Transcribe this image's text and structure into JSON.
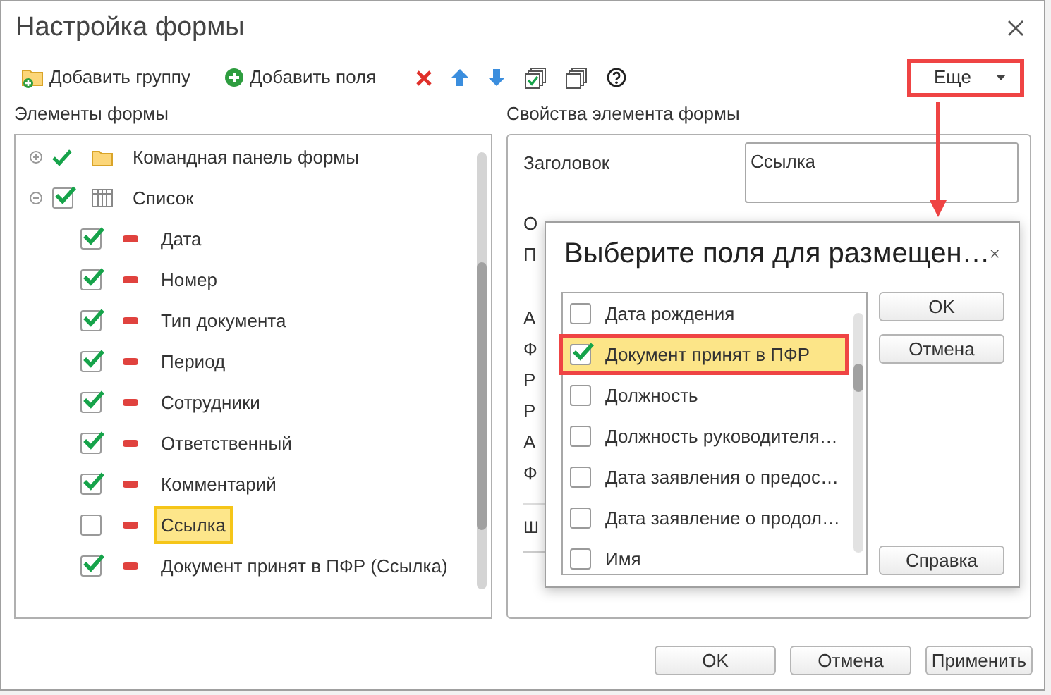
{
  "window": {
    "title": "Настройка формы"
  },
  "toolbar": {
    "add_group": "Добавить группу",
    "add_field": "Добавить поля",
    "more": "Еще",
    "more_highlighted": true
  },
  "form_elements": {
    "title": "Элементы формы",
    "items": [
      {
        "label": "Командная панель формы",
        "kind": "group",
        "checked": true,
        "expanded": false,
        "selected": false
      },
      {
        "label": "Список",
        "kind": "table",
        "checked": true,
        "expanded": true,
        "selected": false,
        "children": [
          {
            "label": "Дата",
            "kind": "field",
            "checked": true,
            "selected": false
          },
          {
            "label": "Номер",
            "kind": "field",
            "checked": true,
            "selected": false
          },
          {
            "label": "Тип документа",
            "kind": "field",
            "checked": true,
            "selected": false
          },
          {
            "label": "Период",
            "kind": "field",
            "checked": true,
            "selected": false
          },
          {
            "label": "Сотрудники",
            "kind": "field",
            "checked": true,
            "selected": false
          },
          {
            "label": "Ответственный",
            "kind": "field",
            "checked": true,
            "selected": false
          },
          {
            "label": "Комментарий",
            "kind": "field",
            "checked": true,
            "selected": false
          },
          {
            "label": "Ссылка",
            "kind": "field",
            "checked": false,
            "selected": true
          },
          {
            "label": "Документ принят в ПФР (Ссылка)",
            "kind": "field",
            "checked": true,
            "selected": false
          }
        ]
      }
    ]
  },
  "properties": {
    "title": "Свойства элемента формы",
    "caption_label": "Заголовок",
    "caption_value": "Ссылка",
    "partial_labels": [
      "О",
      "П",
      "А",
      "Ф",
      "Р",
      "Р",
      "А",
      "Ф"
    ],
    "partial_label_after_rule": "Ш"
  },
  "buttons": [
    "OK",
    "Отмена",
    "Применить"
  ],
  "popup": {
    "title": "Выберите поля для размещен…",
    "items": [
      {
        "label": "Дата рождения",
        "checked": false,
        "selected": false
      },
      {
        "label": "Документ принят в ПФР",
        "checked": true,
        "selected": true
      },
      {
        "label": "Должность",
        "checked": false,
        "selected": false
      },
      {
        "label": "Должность руководителя…",
        "checked": false,
        "selected": false
      },
      {
        "label": "Дата заявления о предос…",
        "checked": false,
        "selected": false
      },
      {
        "label": "Дата заявление о продол…",
        "checked": false,
        "selected": false
      },
      {
        "label": "Имя",
        "checked": false,
        "selected": false
      }
    ],
    "buttons": [
      "OK",
      "Отмена"
    ],
    "help": "Справка"
  }
}
